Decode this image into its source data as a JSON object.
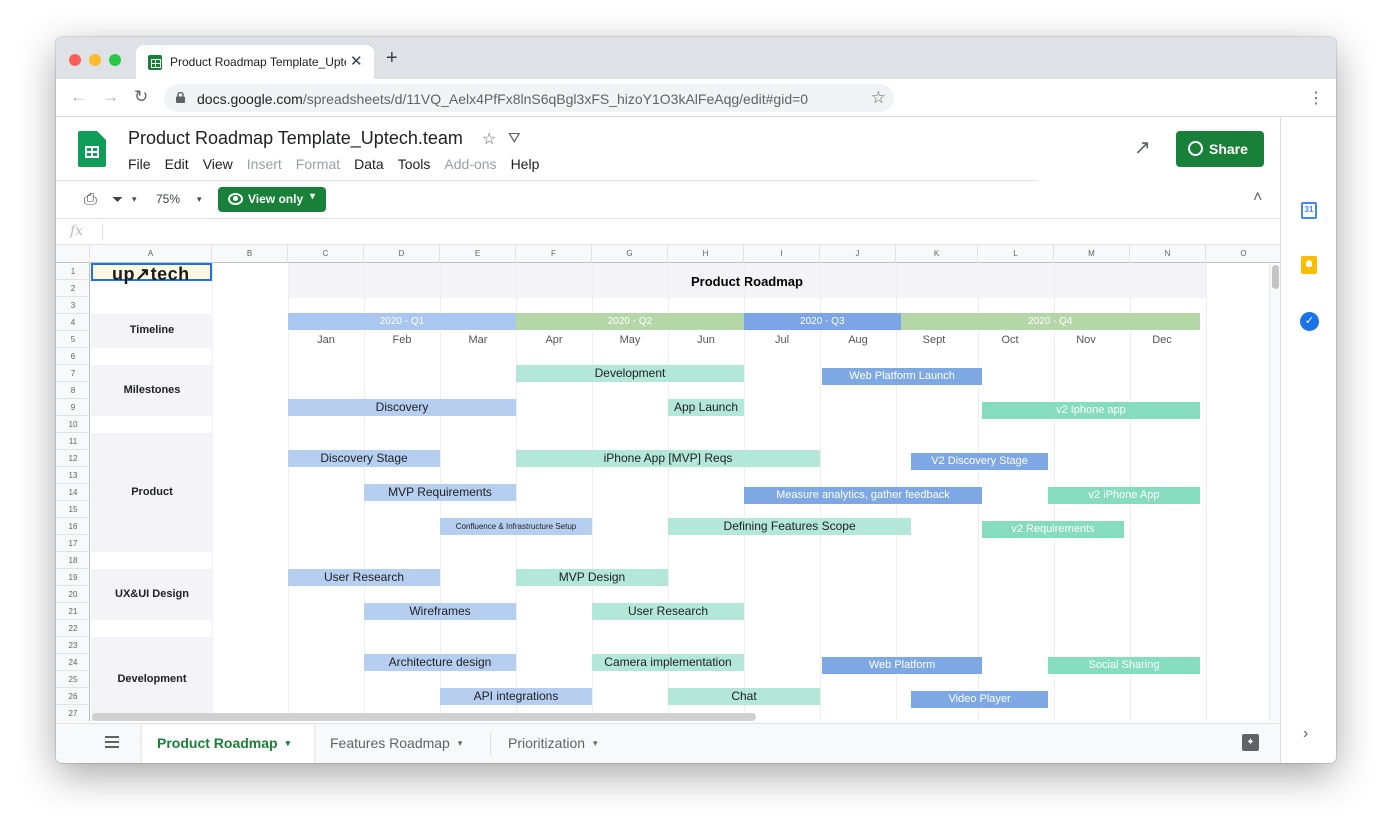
{
  "browser": {
    "tab_title": "Product Roadmap Template_Uptech.team",
    "tab_close": "✕",
    "new_tab": "+",
    "url_host": "docs.google.com",
    "url_path": "/spreadsheets/d/11VQ_Aelx4PfFx8lnS6qBgl3xFS_hizoY1O3kAlFeAqg/edit#gid=0",
    "back": "←",
    "forward": "→",
    "reload": "↻",
    "star": "☆",
    "menu": "⋮",
    "traffic_colors": [
      "#ff5f57",
      "#febc2e",
      "#28c840"
    ]
  },
  "sheets": {
    "doc_title": "Product Roadmap Template_Uptech.team",
    "doc_star": "☆",
    "drive_icon": "⛛",
    "menu": [
      "File",
      "Edit",
      "View",
      "Insert",
      "Format",
      "Data",
      "Tools",
      "Add-ons",
      "Help"
    ],
    "menu_disabled": [
      false,
      false,
      false,
      true,
      true,
      false,
      false,
      true,
      false
    ],
    "trend_icon": "↗",
    "share_label": "Share",
    "accent": "#188038"
  },
  "toolbar": {
    "print_icon": "⎙",
    "filter_icon": "⏷",
    "filter_caret": "▾",
    "zoom": "75%",
    "zoom_caret": "▾",
    "view_only_label": "View only",
    "view_only_caret": "▾",
    "collapse": "˄",
    "fx": "fx"
  },
  "grid": {
    "columns": [
      "A",
      "B",
      "C",
      "D",
      "E",
      "F",
      "G",
      "H",
      "I",
      "J",
      "K",
      "L",
      "M",
      "N",
      "O"
    ],
    "rows": [
      "1",
      "2",
      "3",
      "4",
      "5",
      "6",
      "7",
      "8",
      "9",
      "10",
      "11",
      "12",
      "13",
      "14",
      "15",
      "16",
      "17",
      "18",
      "19",
      "20",
      "21",
      "22",
      "23",
      "24",
      "25",
      "26",
      "27"
    ],
    "logo": "up↗tech",
    "title": "Product Roadmap",
    "sections": [
      {
        "label": "Timeline"
      },
      {
        "label": "Milestones"
      },
      {
        "label": "Product"
      },
      {
        "label": "UX&UI Design"
      },
      {
        "label": "Development"
      }
    ],
    "quarters": [
      {
        "label": "2020 - Q1",
        "color": "#a9c7f0"
      },
      {
        "label": "2020 - Q2",
        "color": "#b5d6a7"
      },
      {
        "label": "2020 - Q3",
        "color": "#7ba5e6"
      },
      {
        "label": "2020 - Q4",
        "color": "#b5d6a7"
      }
    ],
    "months": [
      "Jan",
      "Feb",
      "Mar",
      "Apr",
      "May",
      "Jun",
      "Jul",
      "Aug",
      "Sept",
      "Oct",
      "Nov",
      "Dec"
    ],
    "bars": [
      {
        "label": "Development",
        "color": "#b3e8d8",
        "text_color": "#202124"
      },
      {
        "label": "Web Platform Launch",
        "color": "#7ea8e3",
        "text_color": "#ffffff"
      },
      {
        "label": "Discovery",
        "color": "#b6cff0",
        "text_color": "#202124"
      },
      {
        "label": "App Launch",
        "color": "#b3e8d8",
        "text_color": "#202124"
      },
      {
        "label": "v2 Iphone app",
        "color": "#86dcbf",
        "text_color": "#ffffff"
      },
      {
        "label": "Discovery Stage",
        "color": "#b6cff0",
        "text_color": "#202124"
      },
      {
        "label": "iPhone App [MVP] Reqs",
        "color": "#b3e8d8",
        "text_color": "#202124"
      },
      {
        "label": "V2 Discovery Stage",
        "color": "#7ea8e3",
        "text_color": "#ffffff"
      },
      {
        "label": "MVP Requirements",
        "color": "#b6cff0",
        "text_color": "#202124"
      },
      {
        "label": "Measure analytics, gather feedback",
        "color": "#7ea8e3",
        "text_color": "#ffffff"
      },
      {
        "label": "v2 iPhone App",
        "color": "#86dcbf",
        "text_color": "#ffffff"
      },
      {
        "label": "Confluence & Infrastructure Setup",
        "color": "#b6cff0",
        "text_color": "#202124"
      },
      {
        "label": "Defining Features Scope",
        "color": "#b3e8d8",
        "text_color": "#202124"
      },
      {
        "label": "v2 Requirements",
        "color": "#86dcbf",
        "text_color": "#ffffff"
      },
      {
        "label": "User Research",
        "color": "#b6cff0",
        "text_color": "#202124"
      },
      {
        "label": "MVP Design",
        "color": "#b3e8d8",
        "text_color": "#202124"
      },
      {
        "label": "Wireframes",
        "color": "#b6cff0",
        "text_color": "#202124"
      },
      {
        "label": "User Research",
        "color": "#b3e8d8",
        "text_color": "#202124"
      },
      {
        "label": "Architecture design",
        "color": "#b6cff0",
        "text_color": "#202124"
      },
      {
        "label": "Camera implementation",
        "color": "#b3e8d8",
        "text_color": "#202124"
      },
      {
        "label": "Web Platform",
        "color": "#7ea8e3",
        "text_color": "#ffffff"
      },
      {
        "label": "Social Sharing",
        "color": "#86dcbf",
        "text_color": "#ffffff"
      },
      {
        "label": "API integrations",
        "color": "#b6cff0",
        "text_color": "#202124"
      },
      {
        "label": "Chat",
        "color": "#b3e8d8",
        "text_color": "#202124"
      },
      {
        "label": "Video Player",
        "color": "#7ea8e3",
        "text_color": "#ffffff"
      }
    ]
  },
  "sheet_tabs": [
    {
      "label": "Product Roadmap",
      "caret": "▾"
    },
    {
      "label": "Features Roadmap",
      "caret": "▾"
    },
    {
      "label": "Prioritization",
      "caret": "▾"
    }
  ],
  "side_panel": {
    "calendar_label": "31",
    "tasks_label": "✓",
    "expand": "›",
    "explore_label": "✦"
  }
}
